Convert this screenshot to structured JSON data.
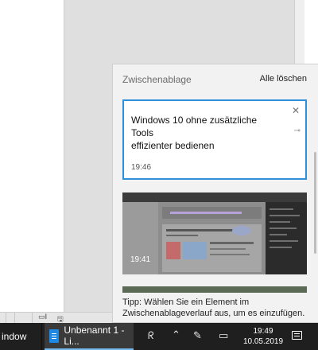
{
  "clipboard": {
    "title": "Zwischenablage",
    "clear_all": "Alle löschen",
    "items": [
      {
        "text": "Windows 10 ohne zusätzliche\nTools\neffizienter bedienen",
        "time": "19:46"
      },
      {
        "type": "image",
        "time": "19:41"
      }
    ],
    "tip": "Tipp: Wählen Sie ein Element im Zwischenablageverlauf aus, um es einzufügen."
  },
  "taskbar": {
    "items": [
      {
        "label": "indow"
      },
      {
        "label": "Unbenannt 1 - Li..."
      }
    ],
    "clock": {
      "time": "19:49",
      "date": "10.05.2019"
    }
  },
  "colors": {
    "accent": "#2f8fd8",
    "taskbar": "#1f1f1f",
    "flyout": "#f2f2f2"
  },
  "icons": [
    "close-icon",
    "pin-icon",
    "people-icon",
    "chevron-up-icon",
    "pen-icon",
    "tablet-icon",
    "notification-icon"
  ]
}
